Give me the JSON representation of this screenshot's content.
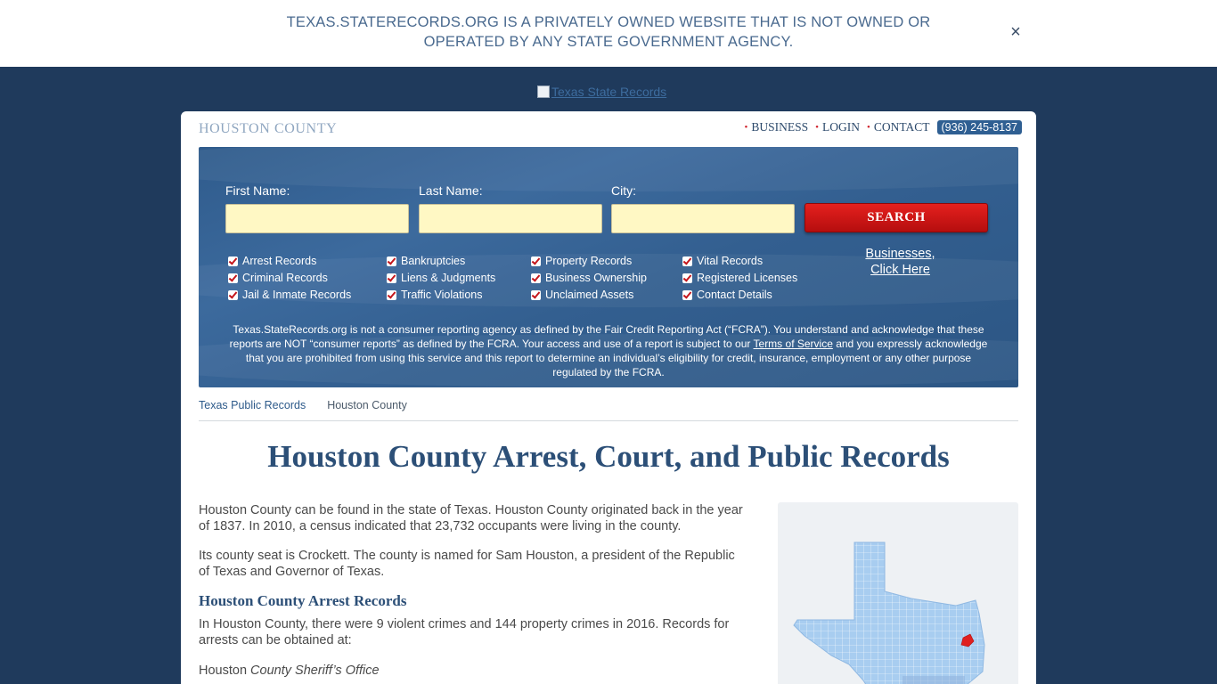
{
  "notice": {
    "text": "TEXAS.STATERECORDS.ORG IS A PRIVATELY OWNED WEBSITE THAT IS NOT OWNED OR OPERATED BY ANY STATE GOVERNMENT AGENCY.",
    "close_icon": "×"
  },
  "logo": {
    "alt": "Texas State Records"
  },
  "header": {
    "county": "HOUSTON COUNTY",
    "nav": [
      "BUSINESS",
      "LOGIN",
      "CONTACT"
    ],
    "phone": "(936) 245-8137"
  },
  "search": {
    "first_name_label": "First Name:",
    "last_name_label": "Last Name:",
    "city_label": "City:",
    "button_label": "SEARCH",
    "checkbox_columns": [
      [
        "Arrest Records",
        "Criminal Records",
        "Jail & Inmate Records"
      ],
      [
        "Bankruptcies",
        "Liens & Judgments",
        "Traffic Violations"
      ],
      [
        "Property Records",
        "Business Ownership",
        "Unclaimed Assets"
      ],
      [
        "Vital Records",
        "Registered Licenses",
        "Contact Details"
      ]
    ],
    "business_link_line1": "Businesses,",
    "business_link_line2": "Click Here",
    "fcra_part1": "Texas.StateRecords.org is not a consumer reporting agency as defined by the Fair Credit Reporting Act (“FCRA”). You understand and acknowledge that these reports are NOT “consumer reports” as defined by the FCRA. Your access and use of a report is subject to our ",
    "fcra_link": "Terms of Service",
    "fcra_part2": " and you expressly acknowledge that you are prohibited from using this service and this report to determine an individual’s eligibility for credit, insurance, employment or any other purpose regulated by the FCRA."
  },
  "breadcrumb": {
    "root": "Texas Public Records",
    "current": "Houston County"
  },
  "main": {
    "title": "Houston County Arrest, Court, and Public Records",
    "para1": "Houston County can be found in the state of Texas. Houston County originated back in the year of 1837. In 2010, a census indicated that 23,732 occupants were living in the county.",
    "para2": "Its county seat is Crockett. The county is named for Sam Houston, a president of the Republic of Texas and Governor of Texas.",
    "arrest_heading": "Houston County Arrest Records",
    "para3": "In Houston County, there were 9 violent crimes and 144 property crimes in 2016. Records for arrests can be obtained at:",
    "office_prefix": "Houston ",
    "office_name": "County Sheriff’s Office"
  },
  "colors": {
    "navy_bg": "#1f3a5c",
    "panel_blue": "#3c6a9d",
    "search_red": "#d0191a",
    "highlight_county": "#e02020",
    "map_fill": "#a8cdf0"
  }
}
